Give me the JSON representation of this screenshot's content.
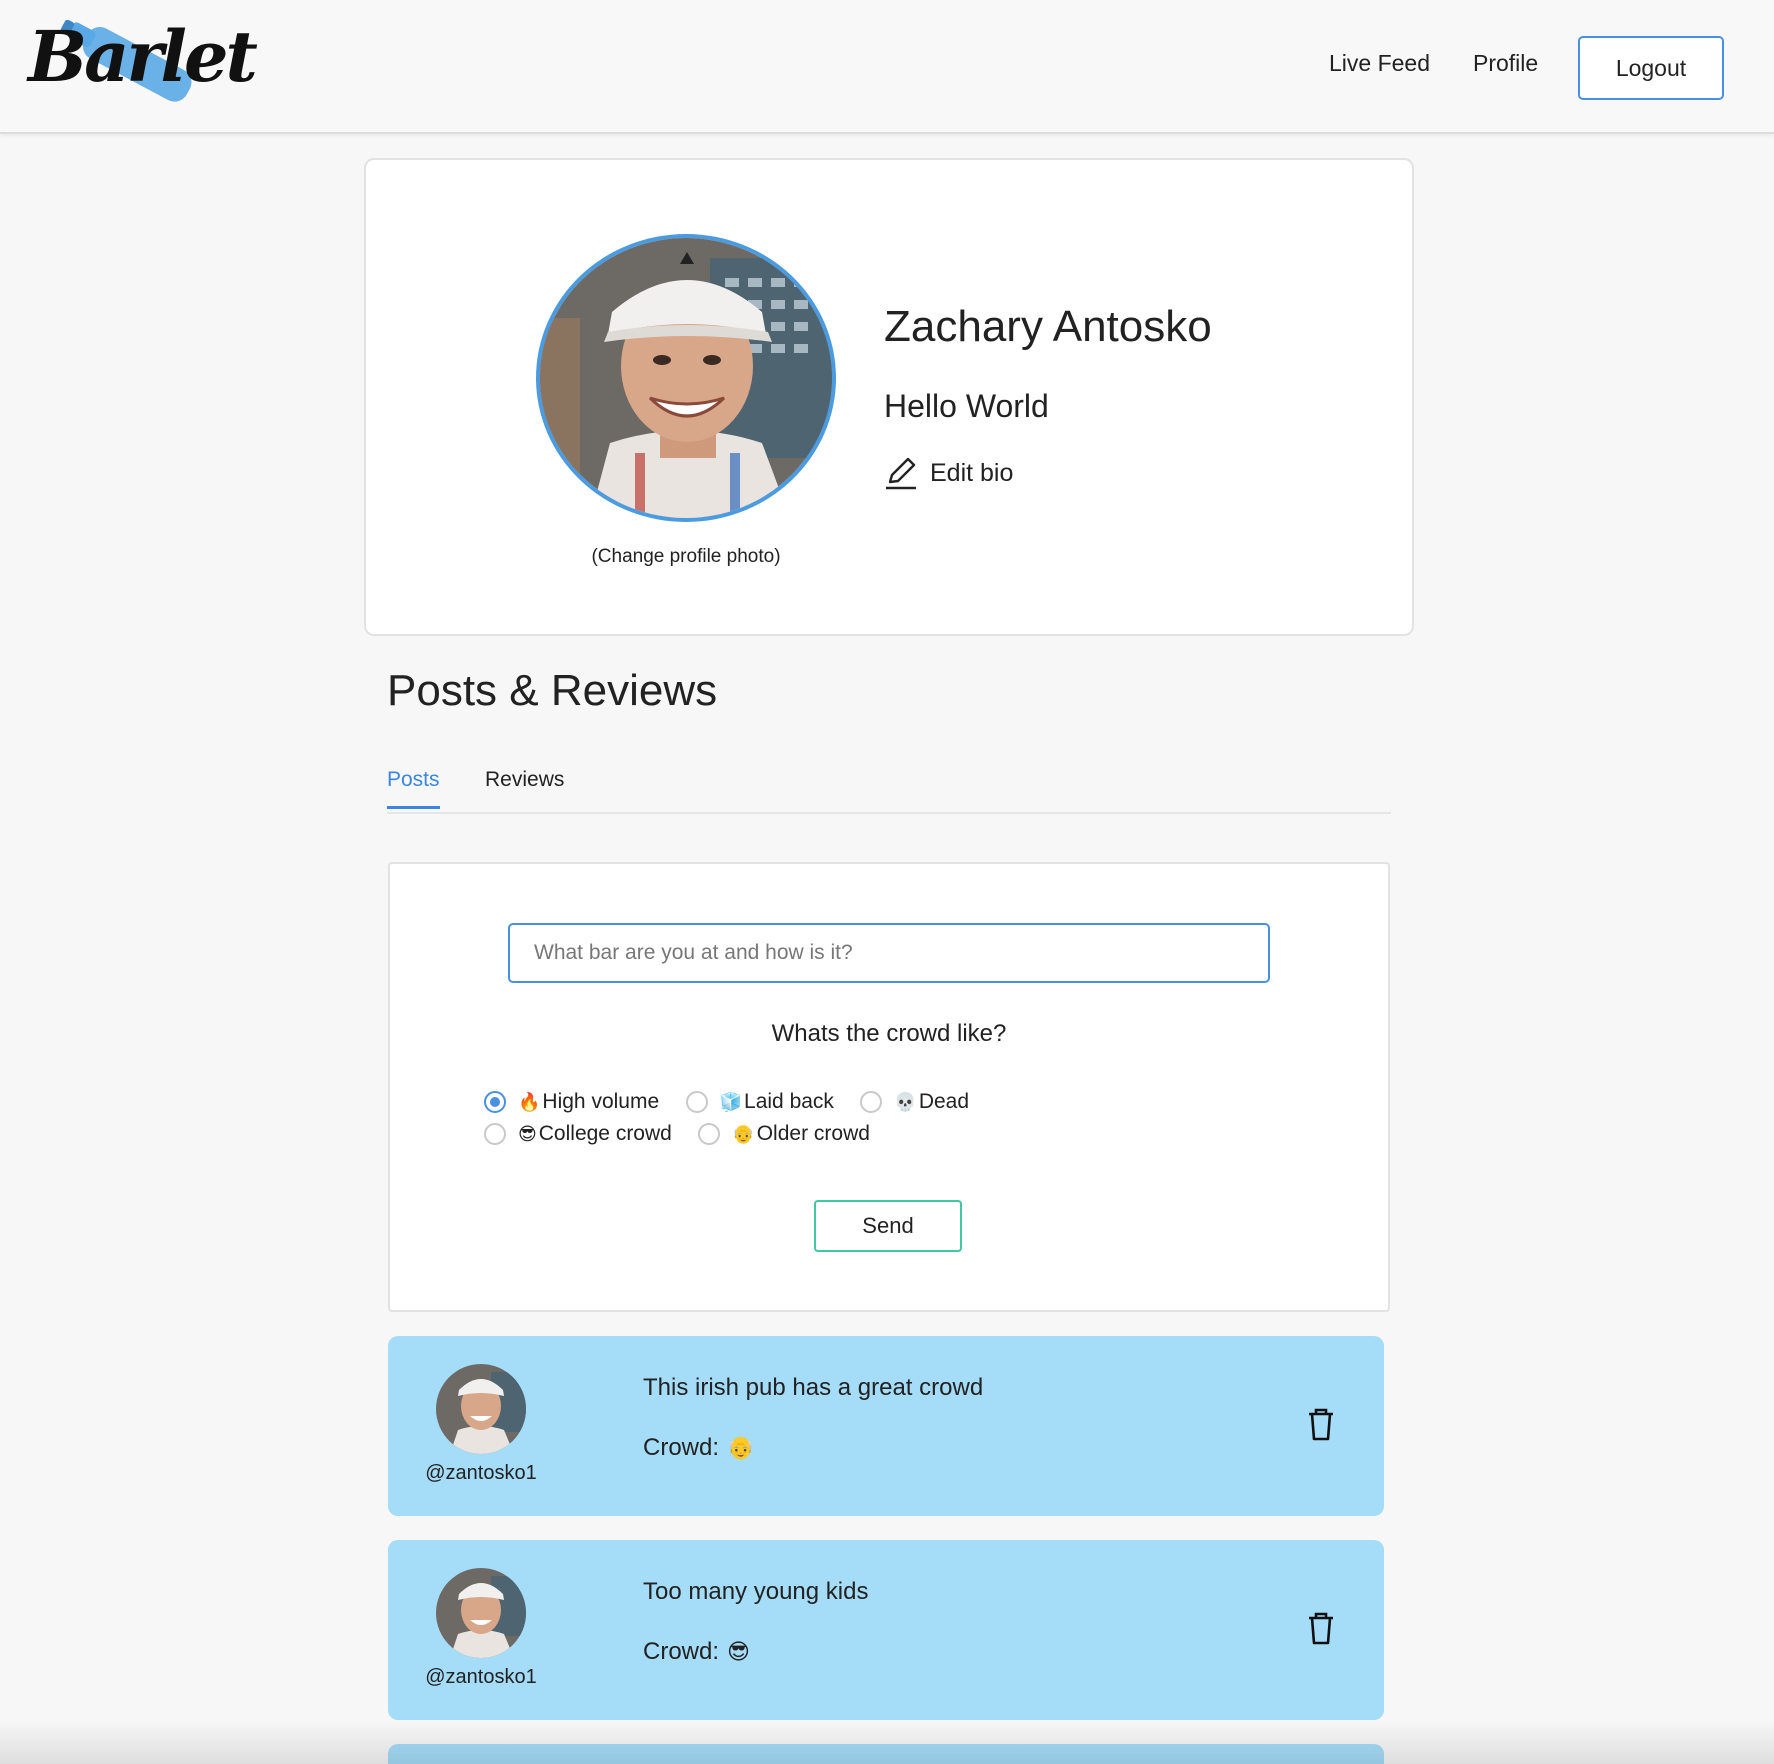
{
  "app": {
    "logo_text": "Barlet"
  },
  "nav": {
    "live_feed": "Live Feed",
    "profile": "Profile",
    "logout": "Logout"
  },
  "profile": {
    "name": "Zachary Antosko",
    "bio": "Hello World",
    "edit_bio": "Edit bio",
    "change_photo": "(Change profile photo)"
  },
  "section": {
    "title": "Posts & Reviews",
    "tabs": [
      {
        "label": "Posts",
        "active": true
      },
      {
        "label": "Reviews",
        "active": false
      }
    ]
  },
  "post_form": {
    "placeholder": "What bar are you at and how is it?",
    "value": "",
    "crowd_question": "Whats the crowd like?",
    "options": [
      {
        "emoji": "🔥",
        "label": "High volume",
        "checked": true
      },
      {
        "emoji": "🧊",
        "label": "Laid back",
        "checked": false
      },
      {
        "emoji": "💀",
        "label": "Dead",
        "checked": false
      },
      {
        "emoji": "😎",
        "label": "College crowd",
        "checked": false
      },
      {
        "emoji": "👴",
        "label": "Older crowd",
        "checked": false
      }
    ],
    "send": "Send"
  },
  "posts": [
    {
      "username": "@zantosko1",
      "text": "This irish pub has a great crowd",
      "crowd_label": "Crowd:",
      "crowd_emoji": "👴"
    },
    {
      "username": "@zantosko1",
      "text": "Too many young kids",
      "crowd_label": "Crowd:",
      "crowd_emoji": "😎"
    }
  ],
  "colors": {
    "accent": "#4a90e2",
    "tab_active": "#3b86e0",
    "send_border": "#40c7a4",
    "post_bg": "#a5dcf8",
    "page_bg": "#f7f7f7"
  }
}
